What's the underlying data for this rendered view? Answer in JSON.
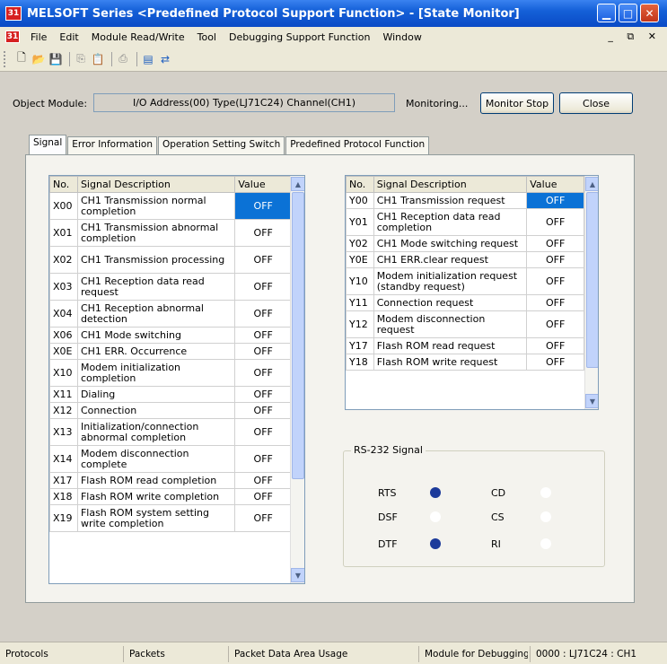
{
  "window": {
    "title": "MELSOFT Series <Predefined Protocol Support Function> - [State Monitor]",
    "icon_label": "31"
  },
  "menu": [
    "File",
    "Edit",
    "Module Read/Write",
    "Tool",
    "Debugging Support Function",
    "Window"
  ],
  "toolbar_icons": [
    "new-icon",
    "open-icon",
    "save-icon",
    "copy-icon",
    "paste-icon",
    "print-icon",
    "monitor-icon",
    "connect-icon"
  ],
  "object_module": {
    "label": "Object Module:",
    "value": "I/O Address(00) Type(LJ71C24) Channel(CH1)",
    "status": "Monitoring...",
    "monitor_stop_label": "Monitor Stop",
    "close_label": "Close"
  },
  "tabs": [
    "Signal",
    "Error Information",
    "Operation Setting Switch",
    "Predefined Protocol Function"
  ],
  "x_table": {
    "headers": [
      "No.",
      "Signal Description",
      "Value"
    ],
    "rows": [
      {
        "no": "X00",
        "desc": "CH1 Transmission normal completion",
        "value": "OFF",
        "selected": true
      },
      {
        "no": "X01",
        "desc": "CH1 Transmission abnormal completion",
        "value": "OFF"
      },
      {
        "no": "X02",
        "desc": "CH1 Transmission processing",
        "value": "OFF"
      },
      {
        "no": "X03",
        "desc": "CH1 Reception data read request",
        "value": "OFF"
      },
      {
        "no": "X04",
        "desc": "CH1 Reception abnormal detection",
        "value": "OFF"
      },
      {
        "no": "X06",
        "desc": "CH1 Mode switching",
        "value": "OFF"
      },
      {
        "no": "X0E",
        "desc": "CH1 ERR. Occurrence",
        "value": "OFF"
      },
      {
        "no": "X10",
        "desc": "Modem initialization completion",
        "value": "OFF"
      },
      {
        "no": "X11",
        "desc": "Dialing",
        "value": "OFF"
      },
      {
        "no": "X12",
        "desc": "Connection",
        "value": "OFF"
      },
      {
        "no": "X13",
        "desc": "Initialization/connection abnormal completion",
        "value": "OFF"
      },
      {
        "no": "X14",
        "desc": "Modem disconnection complete",
        "value": "OFF"
      },
      {
        "no": "X17",
        "desc": "Flash ROM read completion",
        "value": "OFF"
      },
      {
        "no": "X18",
        "desc": "Flash ROM write completion",
        "value": "OFF"
      },
      {
        "no": "X19",
        "desc": "Flash ROM system setting write completion",
        "value": "OFF"
      }
    ]
  },
  "y_table": {
    "headers": [
      "No.",
      "Signal Description",
      "Value"
    ],
    "rows": [
      {
        "no": "Y00",
        "desc": "CH1 Transmission request",
        "value": "OFF",
        "selected": true
      },
      {
        "no": "Y01",
        "desc": "CH1 Reception data read completion",
        "value": "OFF"
      },
      {
        "no": "Y02",
        "desc": "CH1 Mode switching request",
        "value": "OFF"
      },
      {
        "no": "Y0E",
        "desc": "CH1 ERR.clear request",
        "value": "OFF"
      },
      {
        "no": "Y10",
        "desc": "Modem initialization request (standby request)",
        "value": "OFF"
      },
      {
        "no": "Y11",
        "desc": "Connection request",
        "value": "OFF"
      },
      {
        "no": "Y12",
        "desc": "Modem disconnection request",
        "value": "OFF"
      },
      {
        "no": "Y17",
        "desc": "Flash ROM read request",
        "value": "OFF"
      },
      {
        "no": "Y18",
        "desc": "Flash ROM write request",
        "value": "OFF"
      }
    ]
  },
  "rs232": {
    "title": "RS-232 Signal",
    "signals": [
      {
        "name": "RTS",
        "state": "on"
      },
      {
        "name": "CD",
        "state": "off"
      },
      {
        "name": "DSF",
        "state": "off"
      },
      {
        "name": "CS",
        "state": "off"
      },
      {
        "name": "DTF",
        "state": "on"
      },
      {
        "name": "RI",
        "state": "off"
      }
    ],
    "on_color": "#1c3a9a",
    "off_color": "#ffffff"
  },
  "statusbar": [
    "Protocols",
    "Packets",
    "Packet Data Area Usage",
    "Module for Debugging",
    "0000 : LJ71C24 : CH1"
  ],
  "colors": {
    "titlebar": "#1460d8",
    "selection": "#0b72d6",
    "face": "#d4d0c8"
  }
}
